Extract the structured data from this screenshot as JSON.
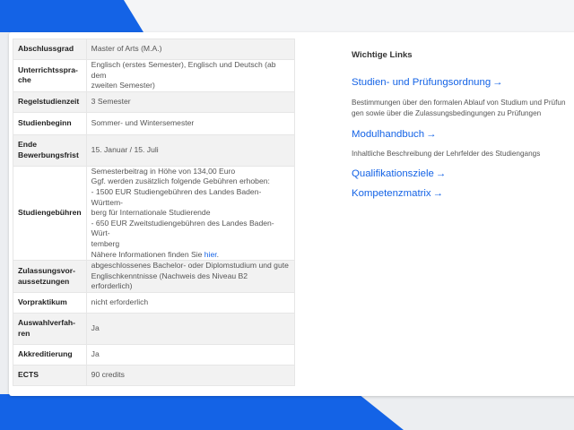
{
  "table": {
    "rows": [
      {
        "label": "Abschlussgrad",
        "value": [
          "Master of Arts (M.A.)"
        ]
      },
      {
        "label": "Unterrichtsspra­che",
        "value": [
          "Englisch (erstes Semester), Englisch und Deutsch (ab dem",
          "zweiten Semester)"
        ]
      },
      {
        "label": "Regelstudienzeit",
        "value": [
          "3 Semester"
        ]
      },
      {
        "label": "Studienbeginn",
        "value": [
          "Sommer- und Wintersemester"
        ]
      },
      {
        "label": "Ende Bewerbungsfrist",
        "value": [
          "15. Januar / 15. Juli"
        ]
      },
      {
        "label": "Studiengebühren",
        "value": [
          "Semesterbeitrag in Höhe von 134,00 Euro",
          "Ggf. werden zusätzlich folgende Gebühren erhoben:",
          "- 1500 EUR Studiengebühren des Landes Baden-Württem-",
          "berg für Internationale Studierende",
          "- 650 EUR Zweitstudiengebühren des Landes Baden-Würt-",
          "temberg"
        ],
        "more_prefix": "Nähere Informationen finden Sie ",
        "more_link": "hier",
        "more_suffix": "."
      },
      {
        "label": "Zulassungsvor­aussetzungen",
        "value": [
          "abgeschlossenes Bachelor- oder Diplomstudium und gute",
          "Englischkenntnisse (Nachweis des Niveau B2 erforderlich)"
        ]
      },
      {
        "label": "Vorpraktikum",
        "value": [
          "nicht erforderlich"
        ]
      },
      {
        "label": "Auswahlverfah­ren",
        "value": [
          "Ja"
        ]
      },
      {
        "label": "Akkreditierung",
        "value": [
          "Ja"
        ]
      },
      {
        "label": "ECTS",
        "value": [
          "90 credits"
        ]
      }
    ]
  },
  "links": {
    "title": "Wichtige Links",
    "items": [
      {
        "label": "Studien- und Prüfungsordnung",
        "arrow": "→",
        "desc": [
          "Bestimmungen über den formalen Ablauf von Studium und Prüfun",
          "gen sowie über die Zulassungsbedingungen zu Prüfungen"
        ]
      },
      {
        "label": "Modulhandbuch",
        "arrow": "→",
        "desc": [
          "Inhaltliche Beschreibung der Lehrfelder des Studiengangs"
        ]
      },
      {
        "label": "Qualifikationsziele",
        "arrow": "→",
        "desc": []
      },
      {
        "label": "Kompetenzmatrix",
        "arrow": "→",
        "desc": []
      }
    ]
  },
  "colors": {
    "accent": "#1463e6",
    "stripe": "#f2f2f2"
  }
}
